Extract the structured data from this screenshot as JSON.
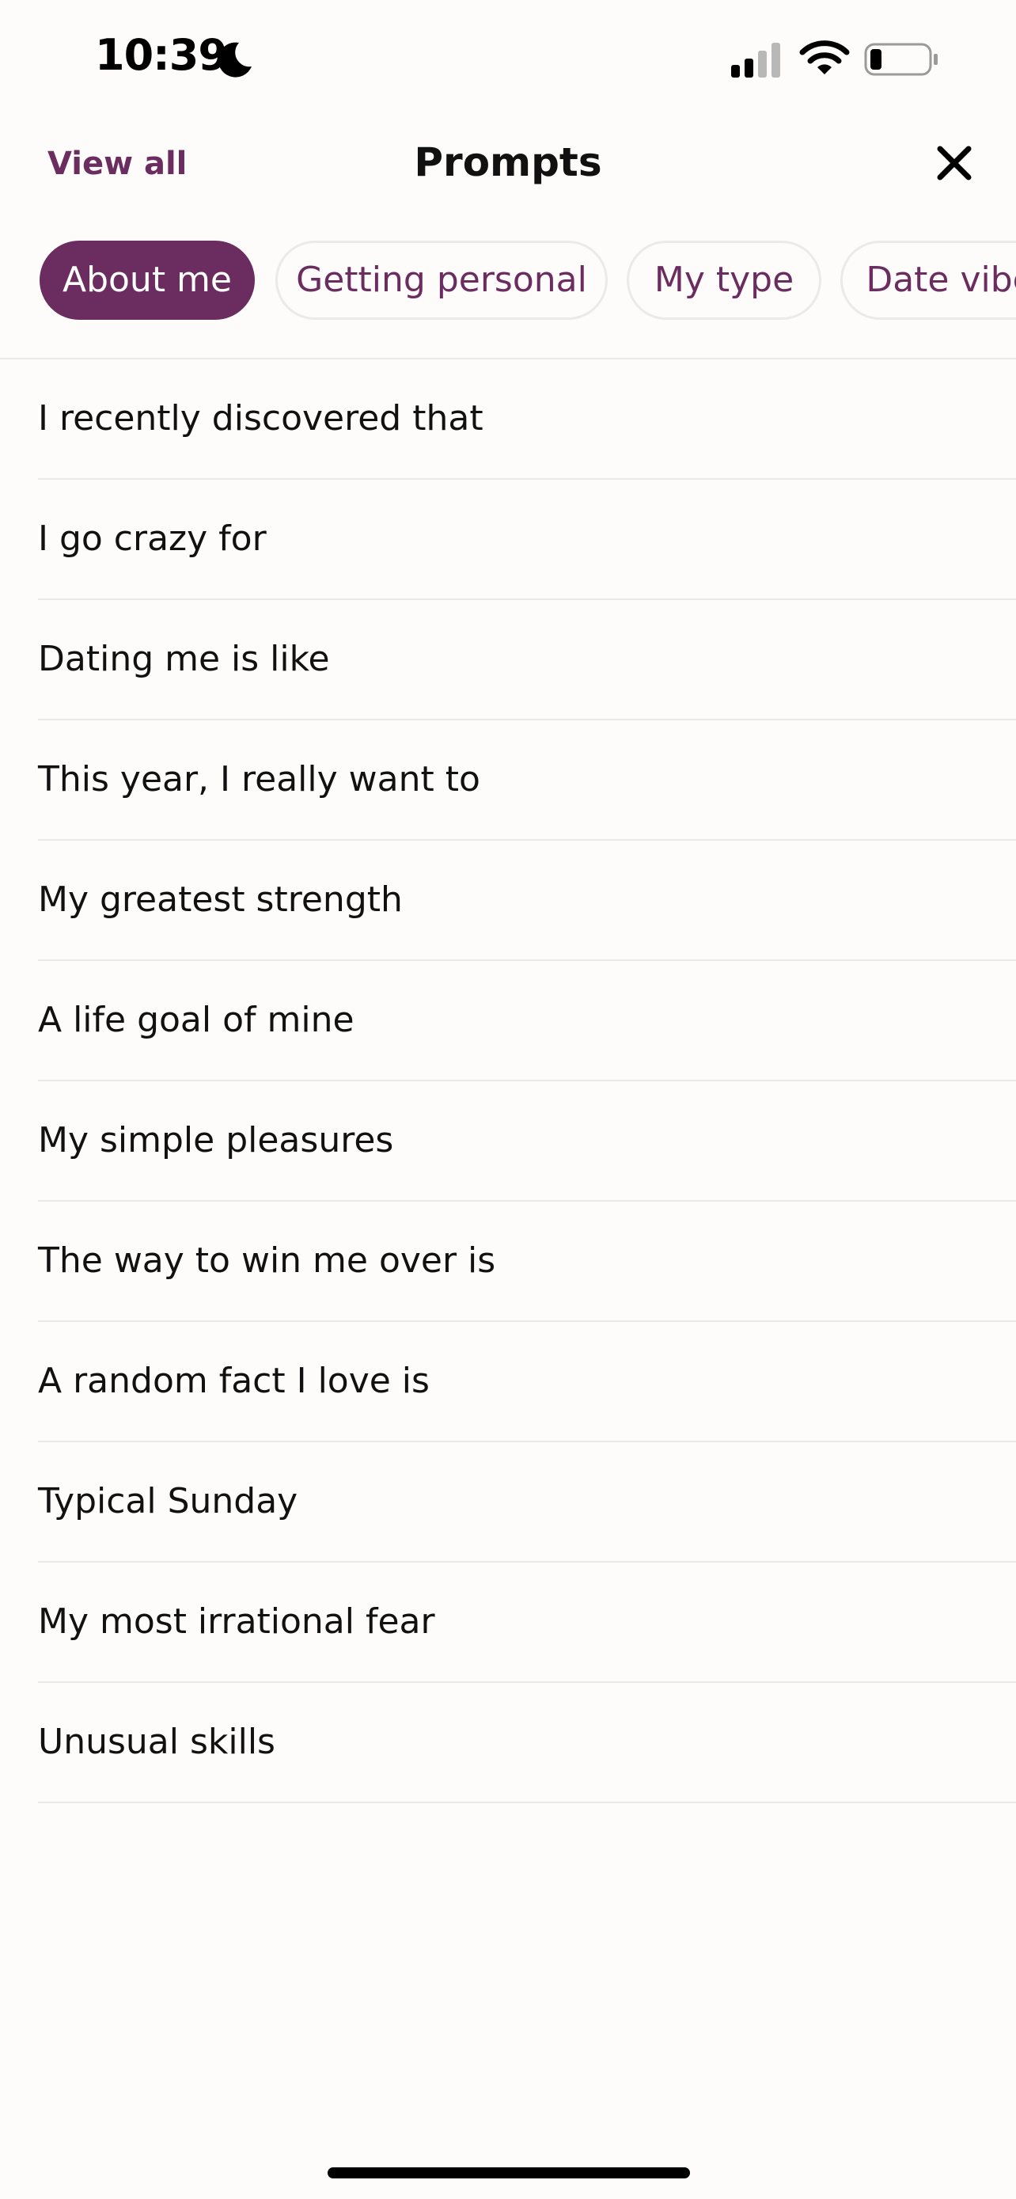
{
  "status_bar": {
    "time": "10:39",
    "icons": [
      "moon-icon",
      "signal-icon",
      "wifi-icon",
      "battery-icon"
    ]
  },
  "nav": {
    "view_all_label": "View all",
    "title": "Prompts",
    "close_icon": "close-icon"
  },
  "tabs": [
    {
      "label": "About me",
      "active": true
    },
    {
      "label": "Getting personal",
      "active": false
    },
    {
      "label": "My type",
      "active": false
    },
    {
      "label": "Date vibes",
      "active": false
    }
  ],
  "prompts": [
    "I recently discovered that",
    "I go crazy for",
    "Dating me is like",
    "This year, I really want to",
    "My greatest strength",
    "A life goal of mine",
    "My simple pleasures",
    "The way to win me over is",
    "A random fact I love is",
    "Typical Sunday",
    "My most irrational fear",
    "Unusual skills"
  ],
  "colors": {
    "accent": "#6b2c5f",
    "background": "#fdfcfb",
    "divider": "#ebe8e6",
    "text": "#111111"
  }
}
